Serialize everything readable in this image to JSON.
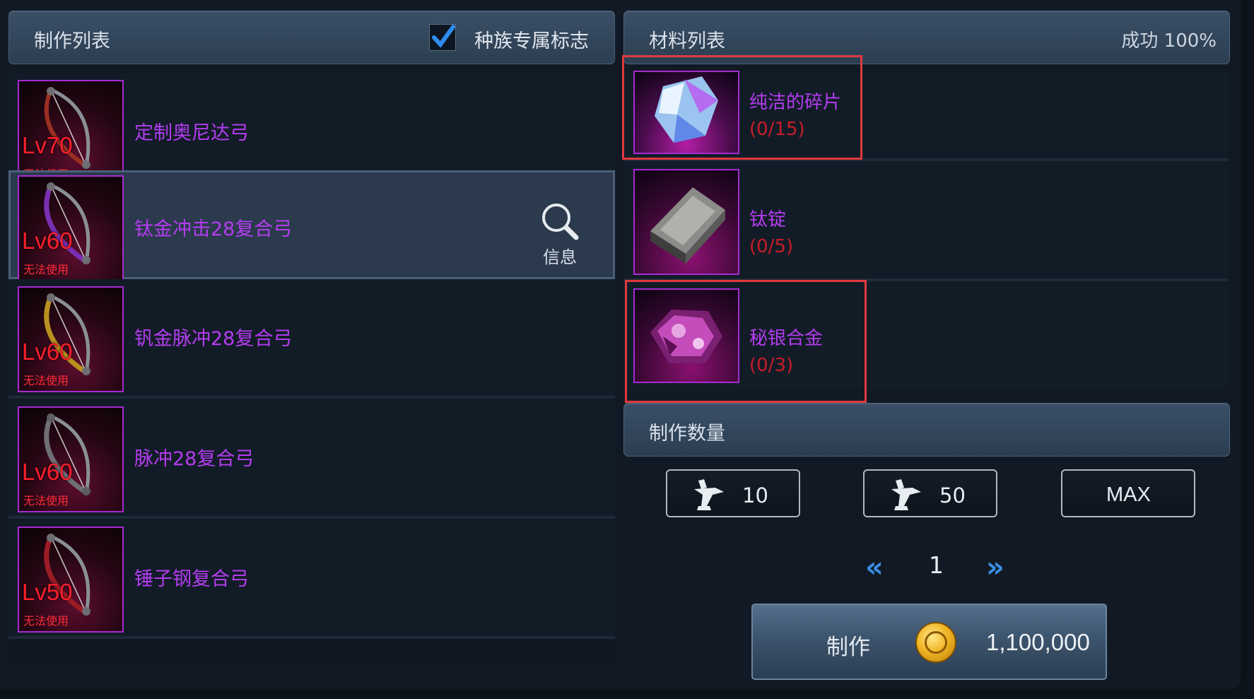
{
  "craft_list": {
    "title": "制作列表",
    "race_flag_label": "种族专属标志",
    "race_flag_checked": true,
    "items": [
      {
        "level": "Lv70",
        "status": "无法使用",
        "name": "定制奥尼达弓",
        "bow_color": "#9a2f22",
        "selected": false
      },
      {
        "level": "Lv60",
        "status": "无法使用",
        "name": "钛金冲击28复合弓",
        "bow_color": "#7a2fb3",
        "selected": true
      },
      {
        "level": "Lv60",
        "status": "无法使用",
        "name": "钒金脉冲28复合弓",
        "bow_color": "#b9911f",
        "selected": false
      },
      {
        "level": "Lv60",
        "status": "无法使用",
        "name": "脉冲28复合弓",
        "bow_color": "#6e6e74",
        "selected": false
      },
      {
        "level": "Lv50",
        "status": "无法使用",
        "name": "锤子钢复合弓",
        "bow_color": "#9c1c26",
        "selected": false
      }
    ],
    "info_label": "信息",
    "info_icon": "magnifier-icon"
  },
  "materials": {
    "title": "材料列表",
    "success_rate": "成功 100%",
    "items": [
      {
        "name": "纯洁的碎片",
        "count": "(0/15)",
        "icon": "crystal-shard-icon"
      },
      {
        "name": "钛锭",
        "count": "(0/5)",
        "icon": "ingot-icon"
      },
      {
        "name": "秘银合金",
        "count": "(0/3)",
        "icon": "alloy-ore-icon"
      }
    ]
  },
  "quantity": {
    "title": "制作数量",
    "btn_10": "10",
    "btn_50": "50",
    "btn_max": "MAX",
    "current": "1",
    "prev_icon": "double-chevron-left-icon",
    "next_icon": "double-chevron-right-icon"
  },
  "craft": {
    "label": "制作",
    "price": "1,100,000",
    "currency_icon": "gold-coin-icon"
  },
  "colors": {
    "item_name": "#b43cf0",
    "count_missing": "#c81c28",
    "highlight_box": "#e0393e",
    "arrow": "#3b8ee6"
  }
}
